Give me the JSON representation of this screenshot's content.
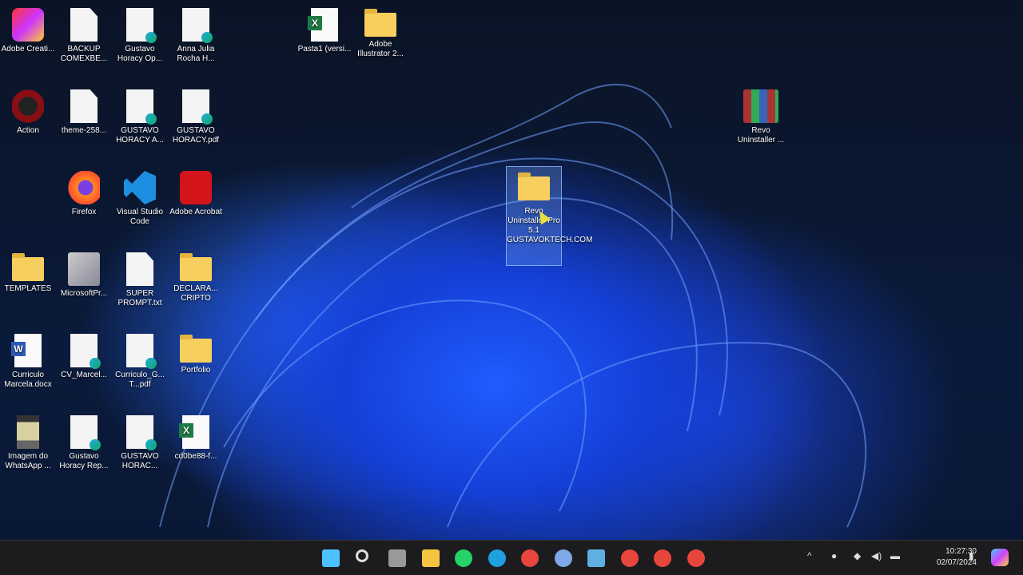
{
  "desktop": {
    "icons": [
      {
        "label": "Adobe Creati...",
        "type": "cc",
        "col": 0,
        "row": 0
      },
      {
        "label": "BACKUP COMEXBE...",
        "type": "doc",
        "col": 1,
        "row": 0
      },
      {
        "label": "Gustavo Horacy Op...",
        "type": "pdf",
        "col": 2,
        "row": 0
      },
      {
        "label": "Anna Julia Rocha H...",
        "type": "pdf",
        "col": 3,
        "row": 0
      },
      {
        "label": "Pasta1 (versi...",
        "type": "excel",
        "col": 5.3,
        "row": 0
      },
      {
        "label": "Adobe Illustrator 2...",
        "type": "folder",
        "col": 6.3,
        "row": 0
      },
      {
        "label": "Action",
        "type": "action",
        "col": 0,
        "row": 1
      },
      {
        "label": "theme-258...",
        "type": "doc",
        "col": 1,
        "row": 1
      },
      {
        "label": "GUSTAVO HORACY A...",
        "type": "pdf",
        "col": 2,
        "row": 1
      },
      {
        "label": "GUSTAVO HORACY.pdf",
        "type": "pdf",
        "col": 3,
        "row": 1
      },
      {
        "label": "Revo Uninstaller ...",
        "type": "rar",
        "col": 13.1,
        "row": 1
      },
      {
        "label": "Firefox",
        "type": "firefox",
        "col": 1,
        "row": 2
      },
      {
        "label": "Visual Studio Code",
        "type": "vscode",
        "col": 2,
        "row": 2
      },
      {
        "label": "Adobe Acrobat",
        "type": "acrobat",
        "col": 3,
        "row": 2
      },
      {
        "label": "TEMPLATES",
        "type": "folder",
        "col": 0,
        "row": 3
      },
      {
        "label": "MicrosoftPr...",
        "type": "installer",
        "col": 1,
        "row": 3
      },
      {
        "label": "SUPER PROMPT.txt",
        "type": "doc",
        "col": 2,
        "row": 3
      },
      {
        "label": "DECLARA... CRIPTO",
        "type": "folder",
        "col": 3,
        "row": 3
      },
      {
        "label": "Curriculo Marcela.docx",
        "type": "word",
        "col": 0,
        "row": 4
      },
      {
        "label": "CV_Marcel...",
        "type": "pdf",
        "col": 1,
        "row": 4
      },
      {
        "label": "Curriculo_G... T...pdf",
        "type": "pdf",
        "col": 2,
        "row": 4
      },
      {
        "label": "Portfolio",
        "type": "folder",
        "col": 3,
        "row": 4
      },
      {
        "label": "Imagem do WhatsApp ...",
        "type": "image",
        "col": 0,
        "row": 5
      },
      {
        "label": "Gustavo Horacy Rep...",
        "type": "pdf",
        "col": 1,
        "row": 5
      },
      {
        "label": "GUSTAVO HORAC...",
        "type": "pdf",
        "col": 2,
        "row": 5
      },
      {
        "label": "cd0be88-f...",
        "type": "excel",
        "col": 3,
        "row": 5
      }
    ],
    "selected": {
      "label": "Revo Uninstaller Pro 5.1 GUSTAVOKTECH.COM",
      "type": "folder"
    }
  },
  "taskbar": {
    "apps": [
      {
        "name": "start",
        "color": "#4cc2ff"
      },
      {
        "name": "search",
        "color": "#ddd"
      },
      {
        "name": "task-view",
        "color": "#999"
      },
      {
        "name": "file-explorer",
        "color": "#f5c542"
      },
      {
        "name": "whatsapp",
        "color": "#25d366"
      },
      {
        "name": "edge",
        "color": "#1fa0e0"
      },
      {
        "name": "chrome",
        "color": "#e8453c"
      },
      {
        "name": "app-blue",
        "color": "#7fa8e8"
      },
      {
        "name": "notepad",
        "color": "#5fb0e0"
      },
      {
        "name": "chrome-profile-1",
        "color": "#e8453c"
      },
      {
        "name": "chrome-profile-2",
        "color": "#e8453c"
      },
      {
        "name": "chrome-profile-3",
        "color": "#e8453c"
      }
    ]
  },
  "tray": {
    "time": "10:27:30",
    "date": "02/07/2024"
  }
}
